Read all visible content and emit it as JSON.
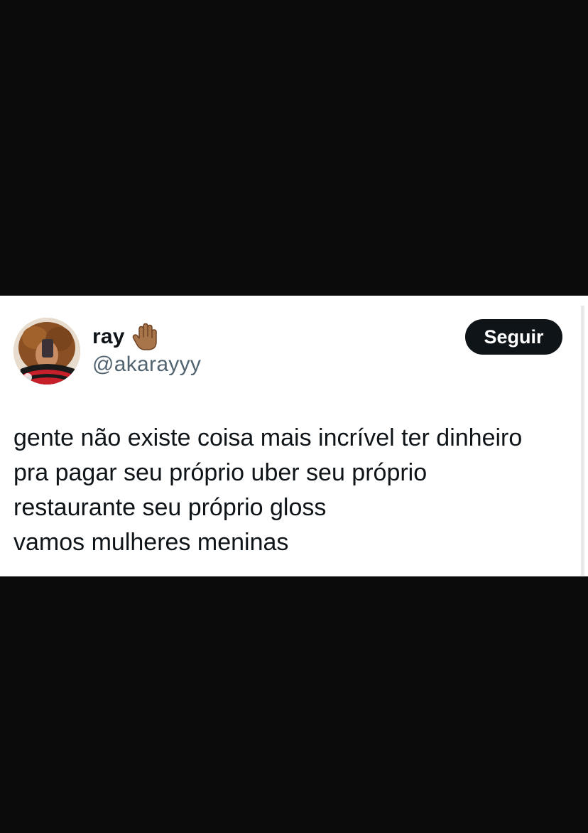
{
  "colors": {
    "background": "#0b0b0c",
    "card": "#ffffff",
    "text_primary": "#0f1419",
    "text_secondary": "#536471",
    "button_bg": "#0f1419",
    "button_text": "#ffffff"
  },
  "author": {
    "display_name": "ray",
    "name_emoji": "raised-hand-icon",
    "handle": "@akarayyy",
    "avatar": "profile-photo"
  },
  "actions": {
    "follow_label": "Seguir"
  },
  "tweet": {
    "lines": [
      "gente não existe coisa mais incrível ter dinheiro",
      "pra pagar seu próprio uber seu próprio",
      "restaurante seu próprio gloss",
      "vamos mulheres meninas"
    ]
  }
}
